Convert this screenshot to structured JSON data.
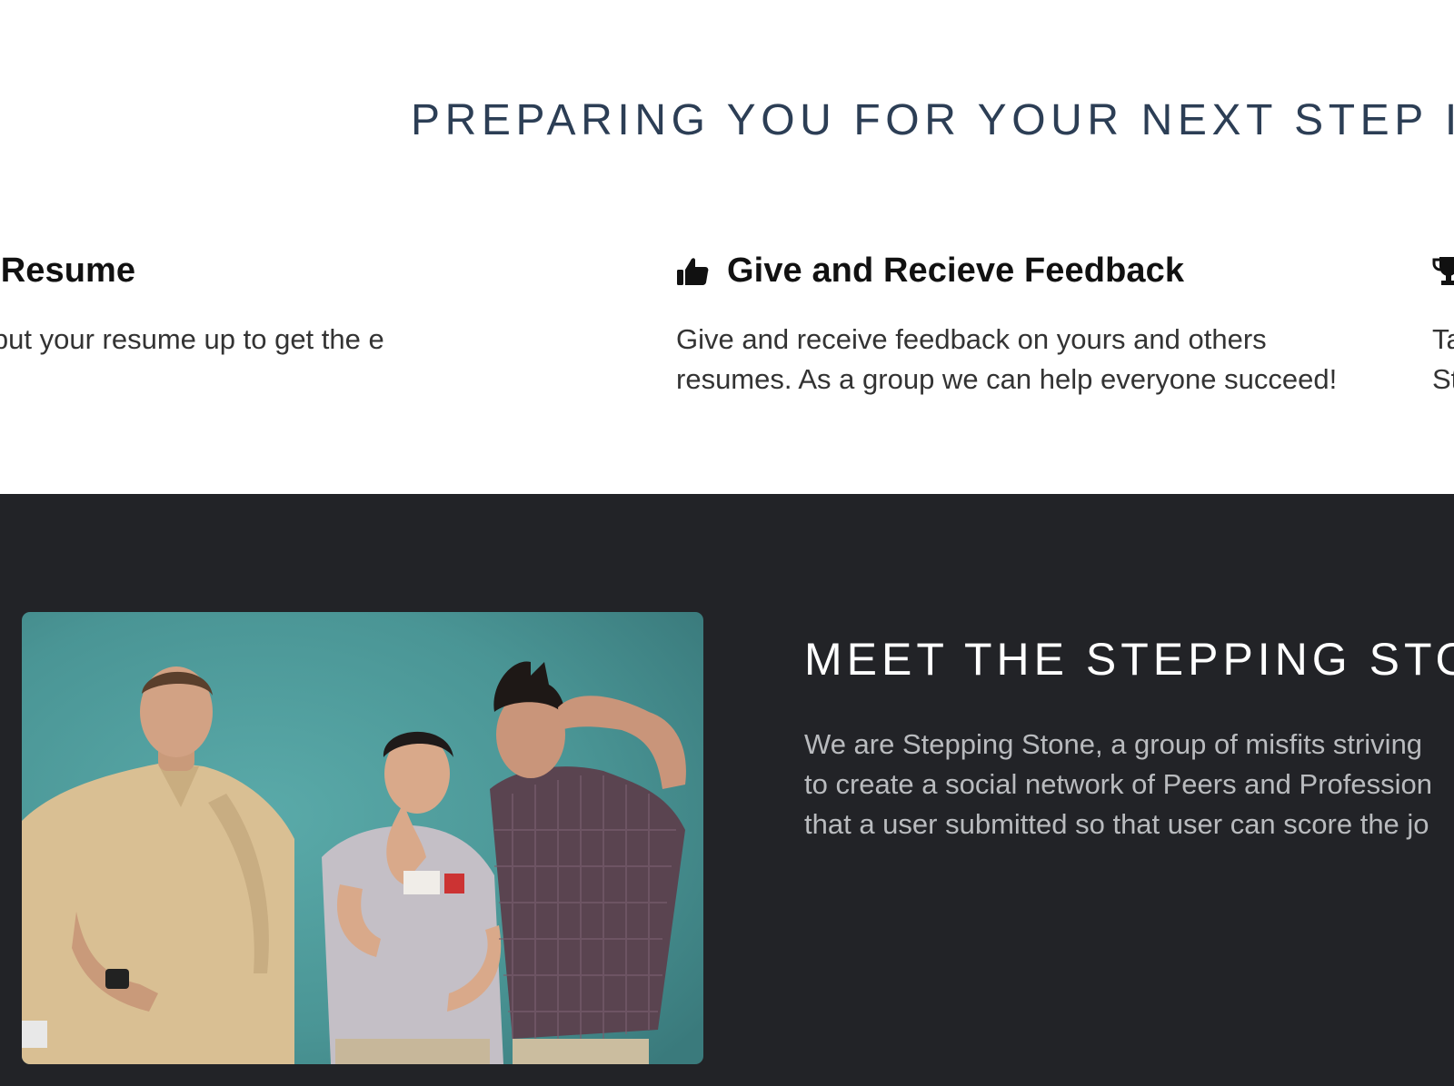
{
  "features_section": {
    "title": "PREPARING YOU FOR YOUR NEXT STEP I",
    "items": [
      {
        "icon": "upload-icon",
        "title": "ubmit Your Resume",
        "text": "ur uploader to put your resume up to get the e you need."
      },
      {
        "icon": "thumbs-up-icon",
        "title": "Give and Recieve Feedback",
        "text": "Give and receive feedback on yours and others resumes. As a group we can help everyone succeed!"
      },
      {
        "icon": "trophy-icon",
        "title": "",
        "text": "Ta St"
      }
    ]
  },
  "team_section": {
    "title": "MEET THE STEPPING STO",
    "text_lines": [
      "We are Stepping Stone, a group of misfits striving",
      "to create a social network of Peers and Profession",
      "that a user submitted so that user can score the jo"
    ],
    "photo": {
      "name": "team-photo"
    }
  },
  "colors": {
    "features_background": "#ffffff",
    "features_title": "#2c3e55",
    "feature_heading": "#111111",
    "feature_text": "#333333",
    "team_background": "#222327",
    "team_title": "#ffffff",
    "team_text": "#b9bbbe",
    "photo_wall": "#4a9a9c"
  }
}
